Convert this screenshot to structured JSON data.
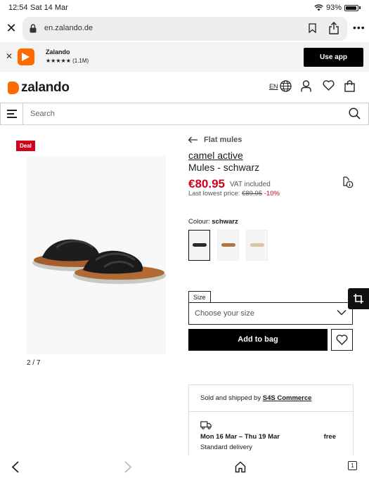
{
  "status_bar": {
    "time": "12:54",
    "date": "Sat 14 Mar",
    "battery": "93%",
    "battery_level": 0.93
  },
  "browser": {
    "url": "en.zalando.de"
  },
  "app_banner": {
    "title": "Zalando",
    "rating": "★★★★★ (1.1M)",
    "cta": "Use app"
  },
  "header": {
    "logo": "zalando",
    "lang": "EN"
  },
  "search": {
    "placeholder": "Search"
  },
  "gallery": {
    "badge": "Deal",
    "pager": "2 / 7"
  },
  "product": {
    "category": "Flat mules",
    "brand": "camel active",
    "name": "Mules - schwarz",
    "price": "€80.95",
    "vat": "VAT included",
    "lowest_label": "Last lowest price:",
    "lowest_price": "€89.95",
    "discount": "-10%",
    "colour_label": "Colour:",
    "colour_value": "schwarz",
    "swatches": [
      {
        "color": "#2a2a2a",
        "selected": true
      },
      {
        "color": "#b4733c",
        "selected": false
      },
      {
        "color": "#d8c6a8",
        "selected": false
      }
    ]
  },
  "size": {
    "label": "Size",
    "placeholder": "Choose your size"
  },
  "actions": {
    "add_to_bag": "Add to bag"
  },
  "seller": {
    "prefix": "Sold and shipped by",
    "name": "S4S Commerce",
    "delivery_date": "Mon 16 Mar – Thu 19 Mar",
    "delivery_cost": "free",
    "delivery_type": "Standard delivery"
  },
  "bottom_bar": {
    "tabs_count": "1"
  },
  "colors": {
    "brand": "#ff6900",
    "price_red": "#d0021b"
  }
}
